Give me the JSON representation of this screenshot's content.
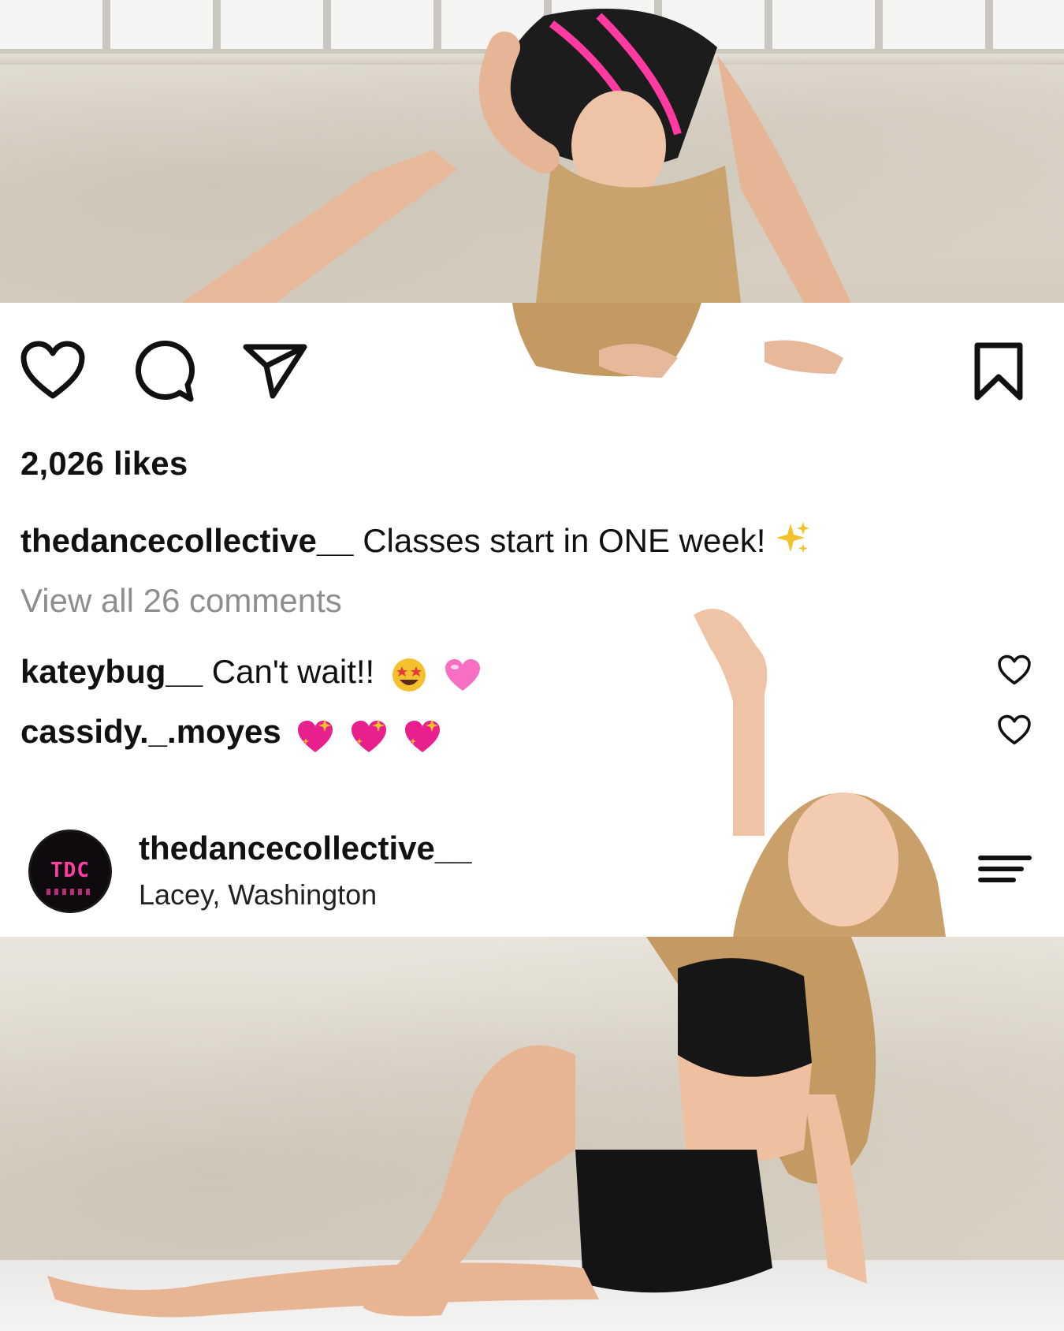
{
  "post": {
    "likes": "2,026 likes",
    "caption_user": "thedancecollective__",
    "caption_text": " Classes start in ONE week! ",
    "view_all": "View all 26 comments"
  },
  "comments": [
    {
      "user": "kateybug__",
      "text": " Can't wait!!",
      "emojis": [
        "star-struck-face",
        "pink-heart"
      ]
    },
    {
      "user": "cassidy._.moyes",
      "text": "",
      "emojis": [
        "sparkling-heart",
        "sparkling-heart",
        "sparkling-heart"
      ]
    }
  ],
  "profile": {
    "avatar_text": "TDC",
    "name": "thedancecollective__",
    "location": "Lacey, Washington"
  },
  "colors": {
    "text": "#111111",
    "muted": "#8e8e8e",
    "brand_pink": "#ff3fa4"
  }
}
